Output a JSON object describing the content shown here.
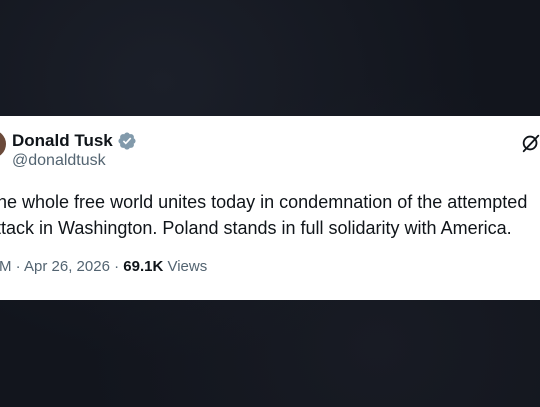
{
  "tweet": {
    "author_name": "Donald Tusk",
    "handle": "@donaldtusk",
    "text_lines": [
      "The whole free world unites today in condemnation of the attempted",
      "attack in Washington. Poland stands in full solidarity with America."
    ],
    "time": "AM",
    "separator": "·",
    "date": "Apr 26, 2026",
    "views_count": "69.1K",
    "views_label": "Views"
  },
  "colors": {
    "background": "#12151d",
    "card": "#ffffff",
    "text_primary": "#0f1419",
    "text_secondary": "#536471",
    "verified_badge": "#829aab"
  },
  "icons": {
    "verified": "verified-badge-icon",
    "grok": "grok-icon"
  }
}
